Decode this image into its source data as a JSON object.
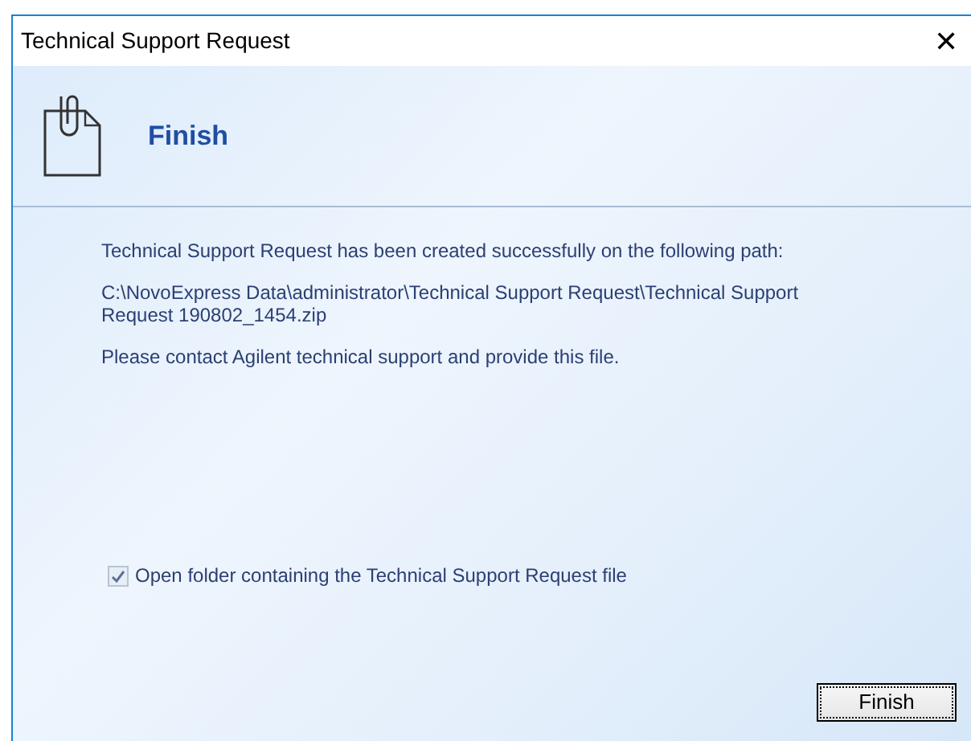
{
  "window": {
    "title": "Technical Support Request",
    "close": "✕"
  },
  "header": {
    "title": "Finish"
  },
  "paragraphs": [
    "Technical Support Request has been created successfully on the following path:",
    "C:\\NovoExpress Data\\administrator\\Technical Support Request\\Technical Support Request 190802_1454.zip",
    "Please contact Agilent technical support and provide this file."
  ],
  "checkbox": {
    "label": "Open folder containing the Technical Support Request file",
    "checked": true,
    "disabled": true
  },
  "buttons": [
    {
      "label": "Finish",
      "focused": true
    }
  ]
}
